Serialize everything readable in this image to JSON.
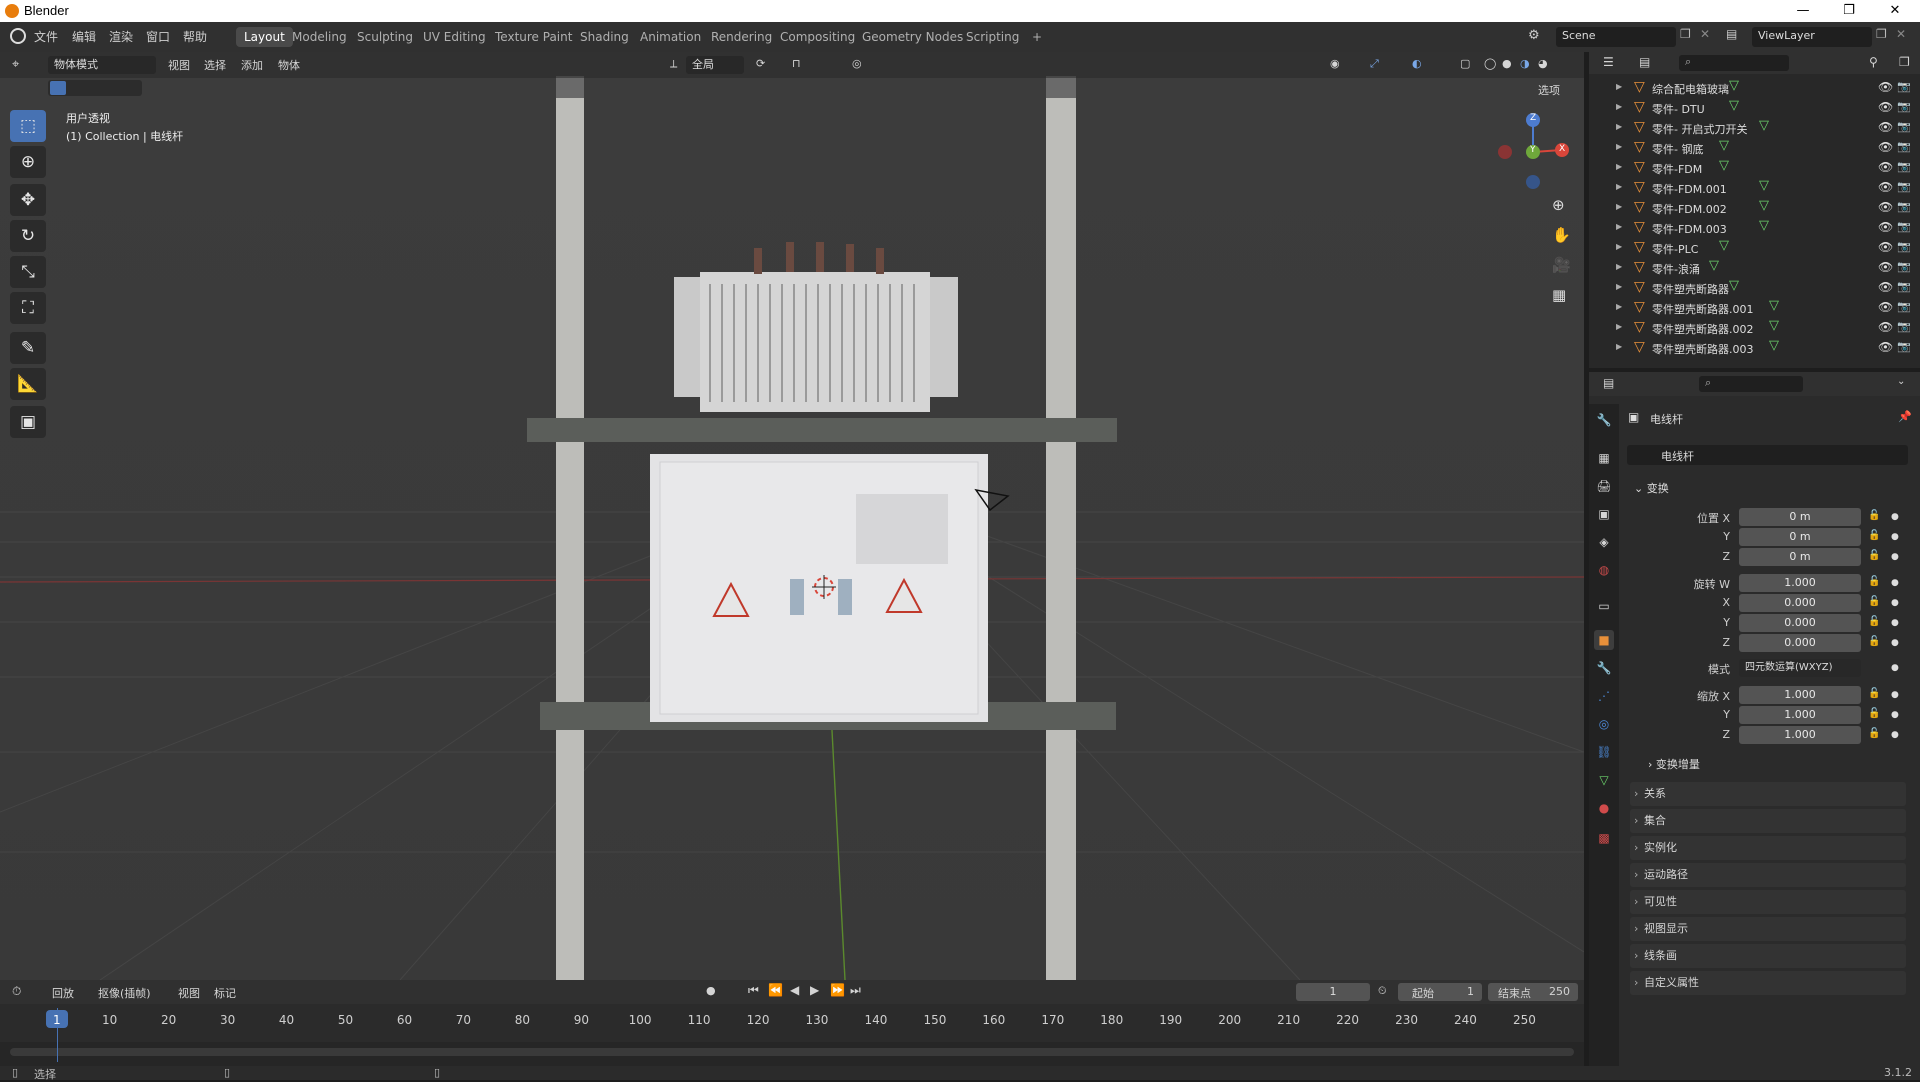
{
  "window": {
    "title": "Blender",
    "controls": [
      "—",
      "❐",
      "✕"
    ]
  },
  "menu": [
    "文件",
    "编辑",
    "渲染",
    "窗口",
    "帮助"
  ],
  "workspaces": [
    {
      "label": "Layout",
      "active": true
    },
    {
      "label": "Modeling"
    },
    {
      "label": "Sculpting"
    },
    {
      "label": "UV Editing"
    },
    {
      "label": "Texture Paint"
    },
    {
      "label": "Shading"
    },
    {
      "label": "Animation"
    },
    {
      "label": "Rendering"
    },
    {
      "label": "Compositing"
    },
    {
      "label": "Geometry Nodes"
    },
    {
      "label": "Scripting"
    }
  ],
  "add_workspace": "+",
  "scene": {
    "name": "Scene",
    "view_layer": "ViewLayer"
  },
  "viewport_header": {
    "mode": "物体模式",
    "menus": [
      "视图",
      "选择",
      "添加",
      "物体"
    ],
    "orientation": "全局",
    "options": "选项"
  },
  "viewport_overlay": {
    "view": "用户透视",
    "collection": "(1) Collection | 电线杆"
  },
  "gizmo": {
    "z": "Z",
    "x": "X",
    "y": "Y"
  },
  "outliner": {
    "items": [
      "综合配电箱玻璃",
      "零件- DTU",
      "零件- 开启式刀开关",
      "零件- 钢底",
      "零件-FDM",
      "零件-FDM.001",
      "零件-FDM.002",
      "零件-FDM.003",
      "零件-PLC",
      "零件-浪涌",
      "零件塑壳断路器",
      "零件塑壳断路器.001",
      "零件塑壳断路器.002",
      "零件塑壳断路器.003"
    ]
  },
  "properties": {
    "object_name": "电线杆",
    "object_field": "电线杆",
    "transform_title": "变换",
    "location": {
      "label_x": "位置 X",
      "label_y": "Y",
      "label_z": "Z",
      "x": "0 m",
      "y": "0 m",
      "z": "0 m"
    },
    "rotation": {
      "label_w": "旋转 W",
      "label_x": "X",
      "label_y": "Y",
      "label_z": "Z",
      "w": "1.000",
      "x": "0.000",
      "y": "0.000",
      "z": "0.000"
    },
    "mode_label": "模式",
    "mode_value": "四元数运算(WXYZ)",
    "scale": {
      "label_x": "缩放 X",
      "label_y": "Y",
      "label_z": "Z",
      "x": "1.000",
      "y": "1.000",
      "z": "1.000"
    },
    "delta": "变换增量",
    "panels": [
      "关系",
      "集合",
      "实例化",
      "运动路径",
      "可见性",
      "视图显示",
      "线条画",
      "自定义属性"
    ]
  },
  "timeline": {
    "menus": [
      "回放",
      "抠像(插帧)",
      "视图",
      "标记"
    ],
    "current_frame": "1",
    "start_label": "起始",
    "start": "1",
    "end_label": "结束点",
    "end": "250",
    "ticks": [
      "1",
      "10",
      "20",
      "30",
      "40",
      "50",
      "60",
      "70",
      "80",
      "90",
      "100",
      "110",
      "120",
      "130",
      "140",
      "150",
      "160",
      "170",
      "180",
      "190",
      "200",
      "210",
      "220",
      "230",
      "240",
      "250"
    ]
  },
  "statusbar": {
    "left": "选择",
    "version": "3.1.2"
  },
  "colors": {
    "accent": "#4772b3",
    "object": "#e8903a",
    "mesh": "#6cd36c"
  }
}
